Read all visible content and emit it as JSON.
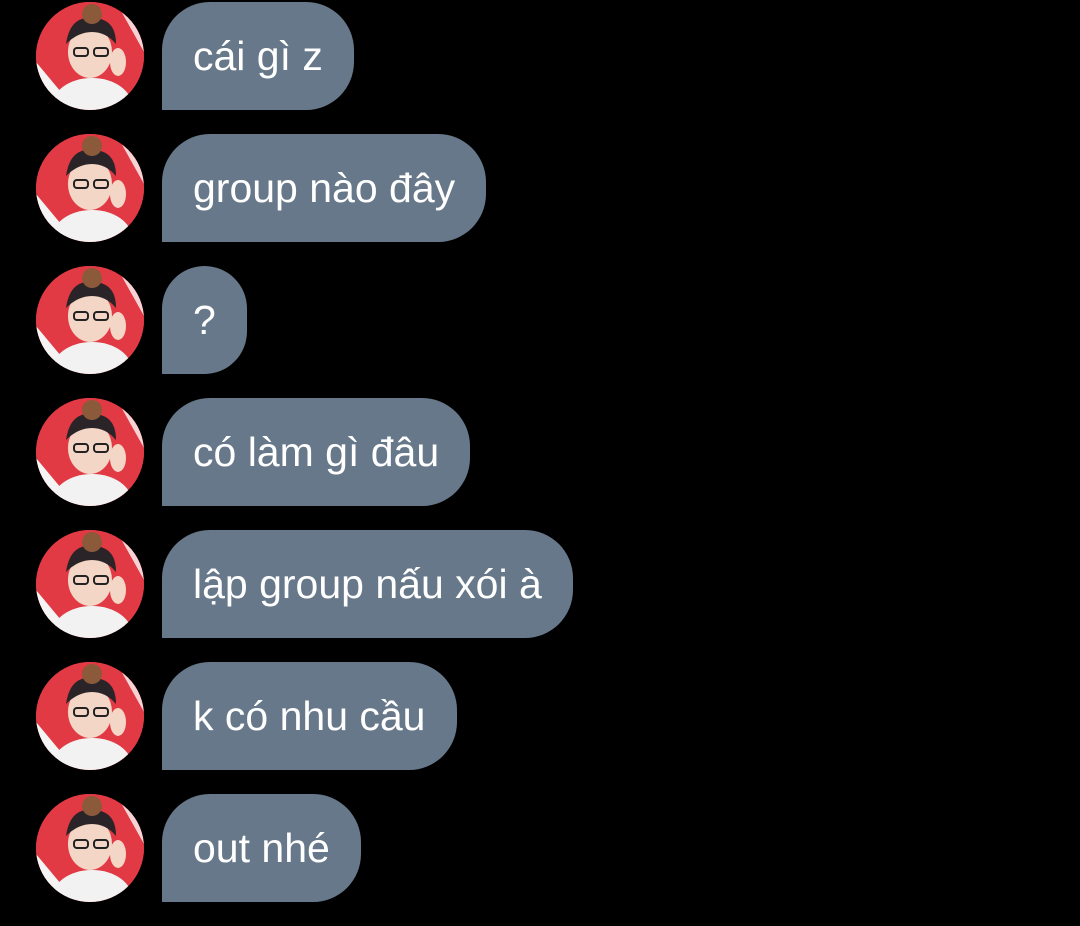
{
  "messages": [
    {
      "text": "cái gì z"
    },
    {
      "text": "group nào đây"
    },
    {
      "text": "?"
    },
    {
      "text": "có làm gì đâu"
    },
    {
      "text": "lập group nấu xói à"
    },
    {
      "text": "k có nhu cầu"
    },
    {
      "text": "out nhé"
    }
  ],
  "colors": {
    "background": "#000000",
    "bubble": "#67788a",
    "text": "#ffffff",
    "avatar_bg": "#e23a44"
  },
  "icons": {
    "avatar": "avatar-photo"
  }
}
